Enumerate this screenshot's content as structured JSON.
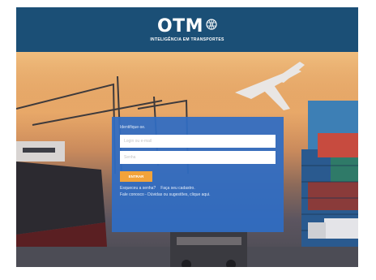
{
  "header": {
    "logo_text": "OTM",
    "logo_subtitle": "INTELIGÊNCIA EM TRANSPORTES",
    "background": "#1b4f76"
  },
  "login": {
    "prompt": "Identifique-se.",
    "username_placeholder": "Login ou e-mail",
    "password_placeholder": "Senha",
    "submit_label": "ENTRAR",
    "forgot_label": "Esqueceu a senha?",
    "register_label": "Faça seu cadastro.",
    "contact_label": "Fale conosco - Dúvidas ou sugestões, clique aqui.",
    "panel_color": "#2f6dc4",
    "button_color": "#f2a33a"
  },
  "hero": {
    "scene": "port-with-cranes-containers-truck-airplane"
  }
}
